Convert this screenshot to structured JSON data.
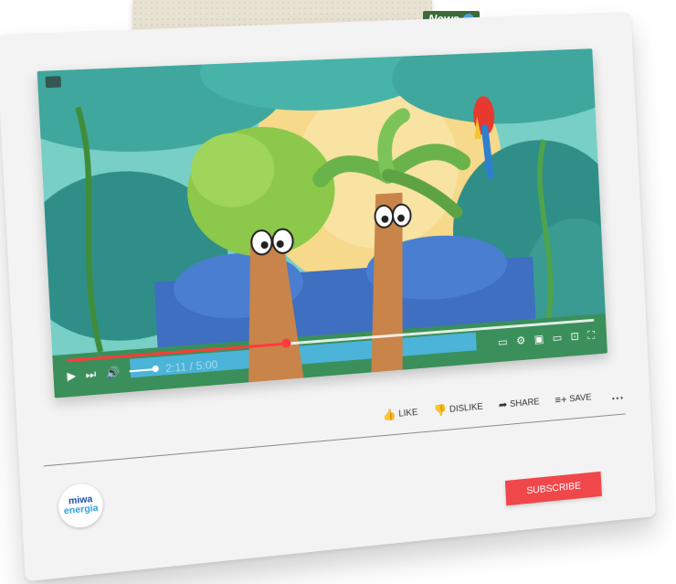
{
  "news": {
    "label": "News"
  },
  "video": {
    "progress_fraction": 0.4,
    "time_label": "2:11 / 5:00"
  },
  "actions": {
    "like": "LIKE",
    "dislike": "DISLIKE",
    "share": "SHARE",
    "save": "SAVE",
    "more": "..."
  },
  "channel": {
    "logo_line1": "miwa",
    "logo_line2": "energia"
  },
  "subscribe_label": "SUBSCRIBE",
  "colors": {
    "accent_red": "#f0474a",
    "progress_red": "#ff3b3b",
    "panel": "#f3f3f3"
  },
  "icons": [
    "camera-icon",
    "play-icon",
    "next-icon",
    "volume-icon",
    "captions-icon",
    "gear-icon",
    "miniplayer-icon",
    "theater-icon",
    "cast-icon",
    "fullscreen-icon",
    "thumbs-up-icon",
    "thumbs-down-icon",
    "share-icon",
    "save-icon"
  ]
}
